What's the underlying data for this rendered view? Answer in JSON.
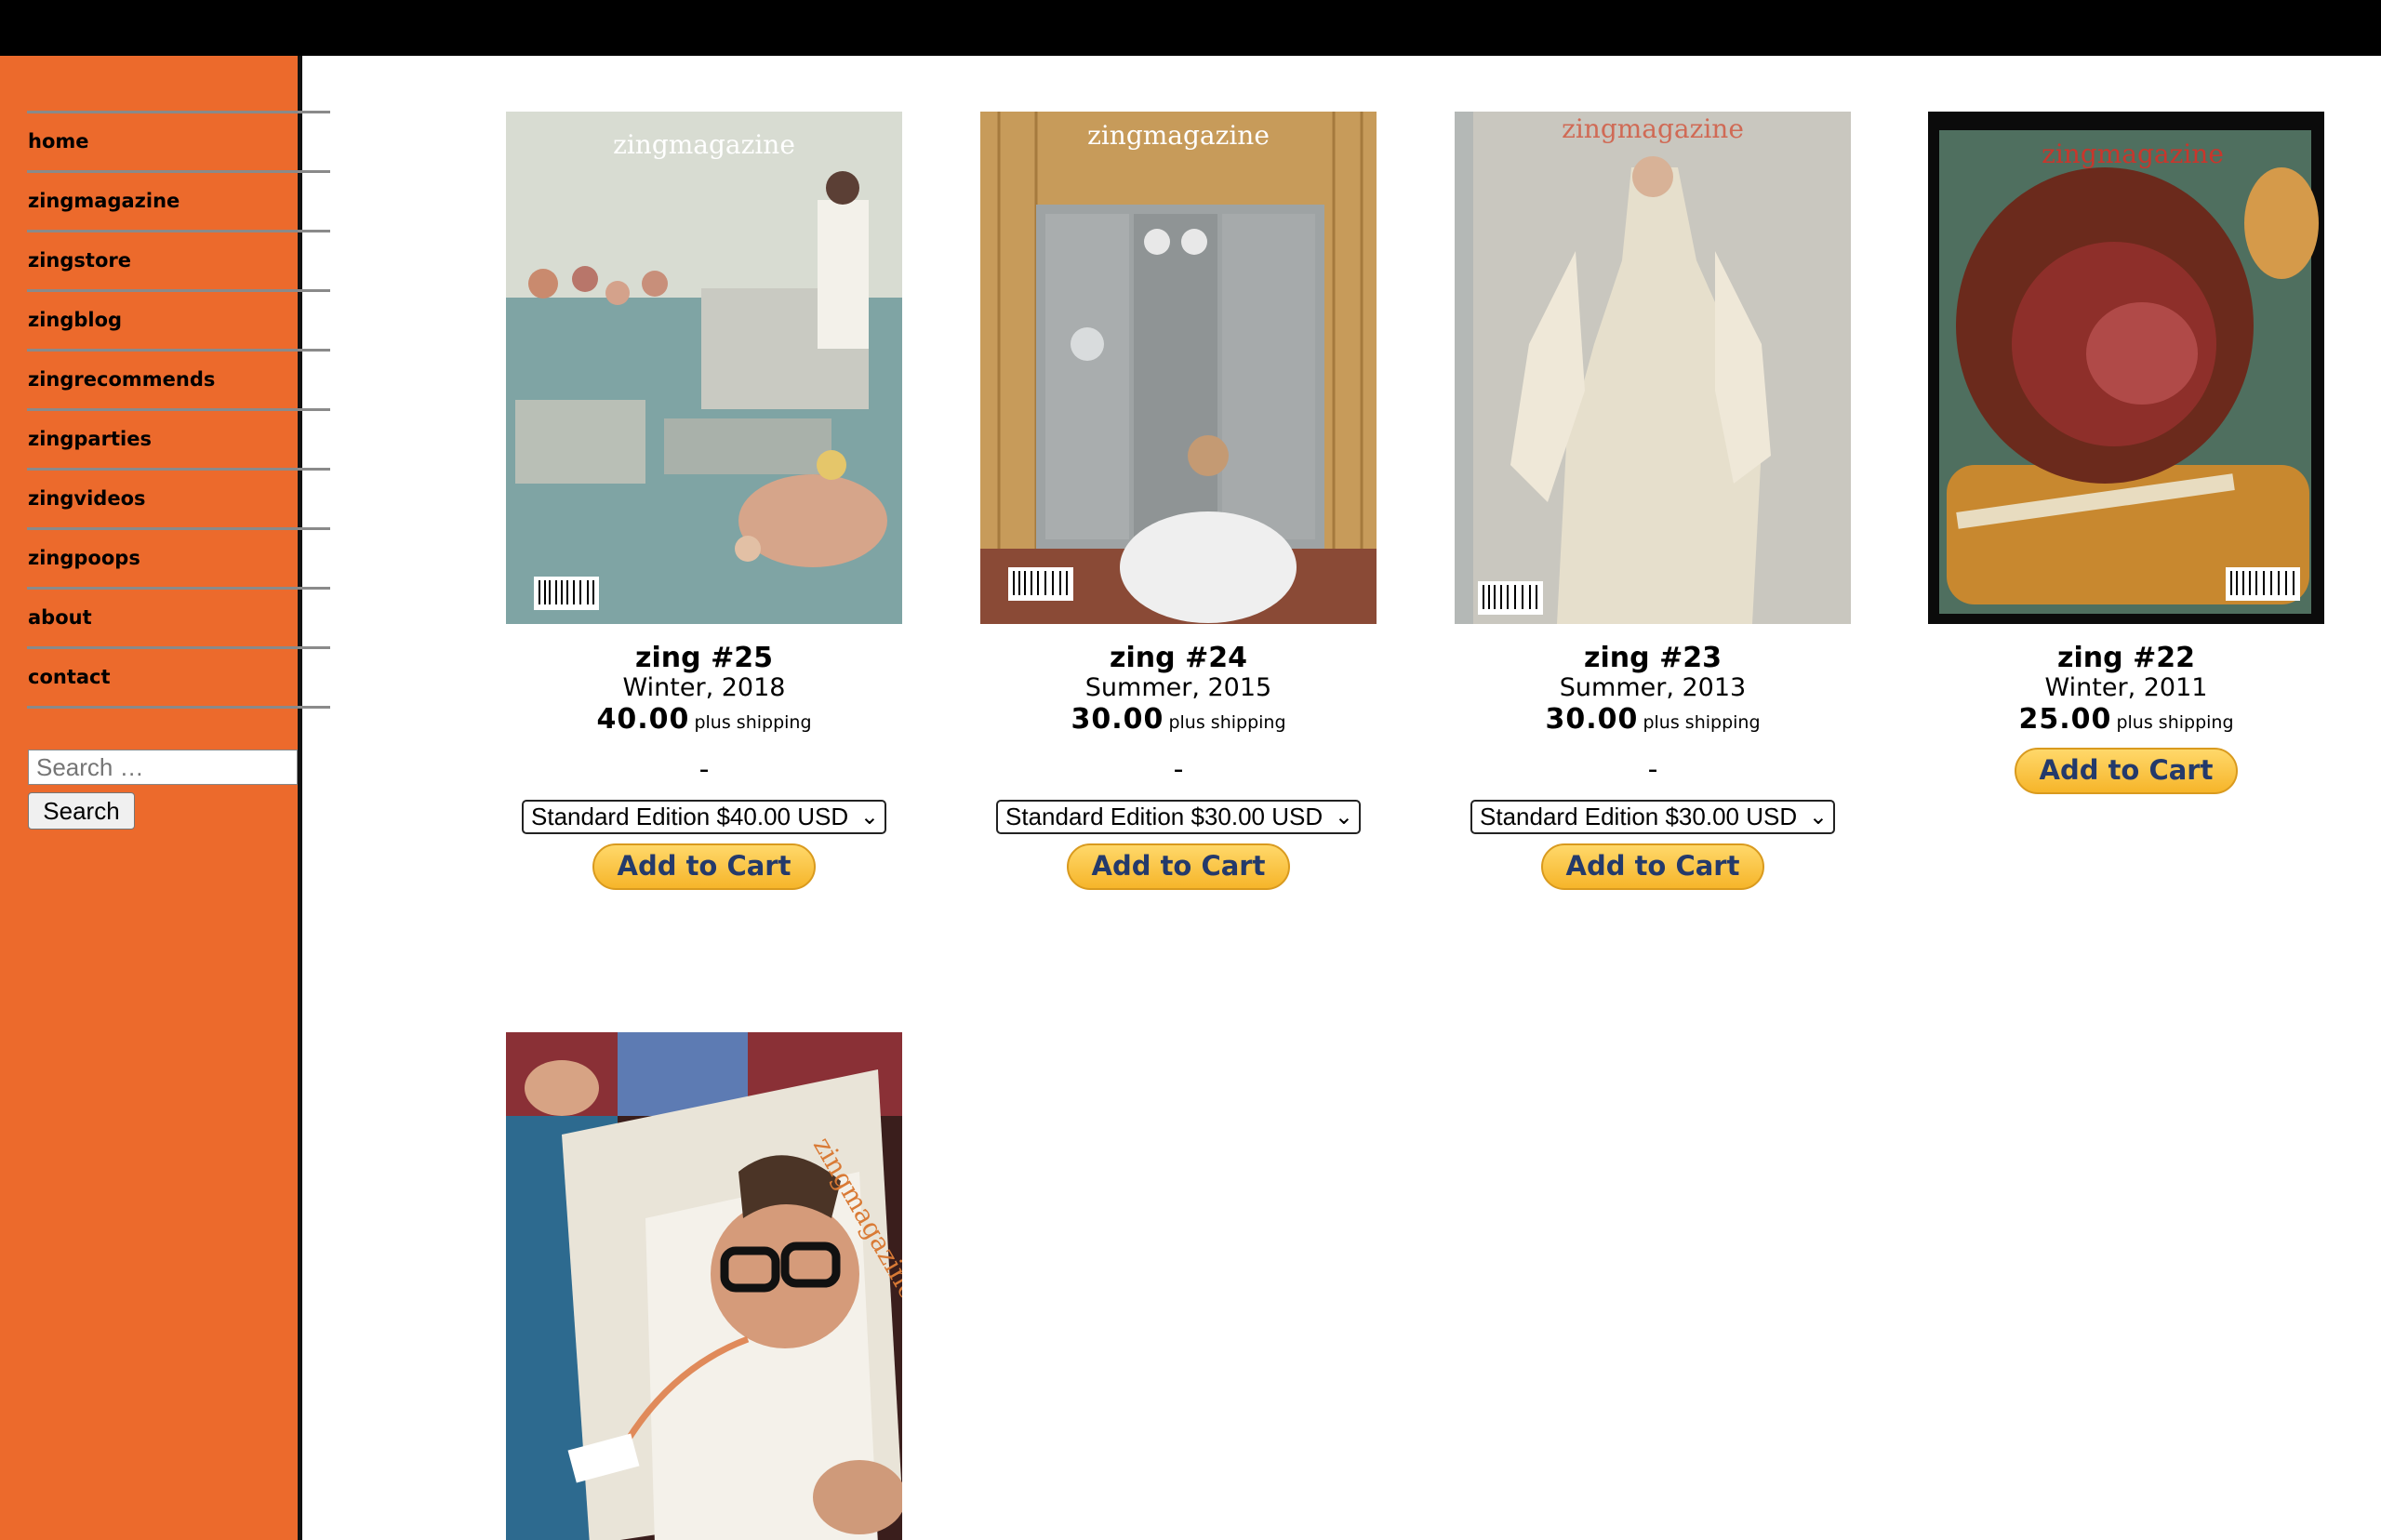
{
  "sidebar": {
    "nav": [
      "home",
      "zingmagazine",
      "zingstore",
      "zingblog",
      "zingrecommends",
      "zingparties",
      "zingvideos",
      "zingpoops",
      "about",
      "contact"
    ],
    "search_placeholder": "Search …",
    "search_button": "Search"
  },
  "cover_brand": "zingmagazine",
  "products": [
    {
      "title": "zing #25",
      "season": "Winter, 2018",
      "price": "40.00",
      "shipping": "plus shipping",
      "dash": "-",
      "option": "Standard Edition $40.00 USD",
      "cart": "Add to Cart"
    },
    {
      "title": "zing #24",
      "season": "Summer, 2015",
      "price": "30.00",
      "shipping": "plus shipping",
      "dash": "-",
      "option": "Standard Edition $30.00 USD",
      "cart": "Add to Cart"
    },
    {
      "title": "zing #23",
      "season": "Summer, 2013",
      "price": "30.00",
      "shipping": "plus shipping",
      "dash": "-",
      "option": "Standard Edition $30.00 USD",
      "cart": "Add to Cart"
    },
    {
      "title": "zing #22",
      "season": "Winter, 2011",
      "price": "25.00",
      "shipping": "plus shipping",
      "cart": "Add to Cart"
    }
  ],
  "colors": {
    "sidebar": "#ec6a2c",
    "topbar": "#000000",
    "cart_button": "#f6b52a"
  }
}
